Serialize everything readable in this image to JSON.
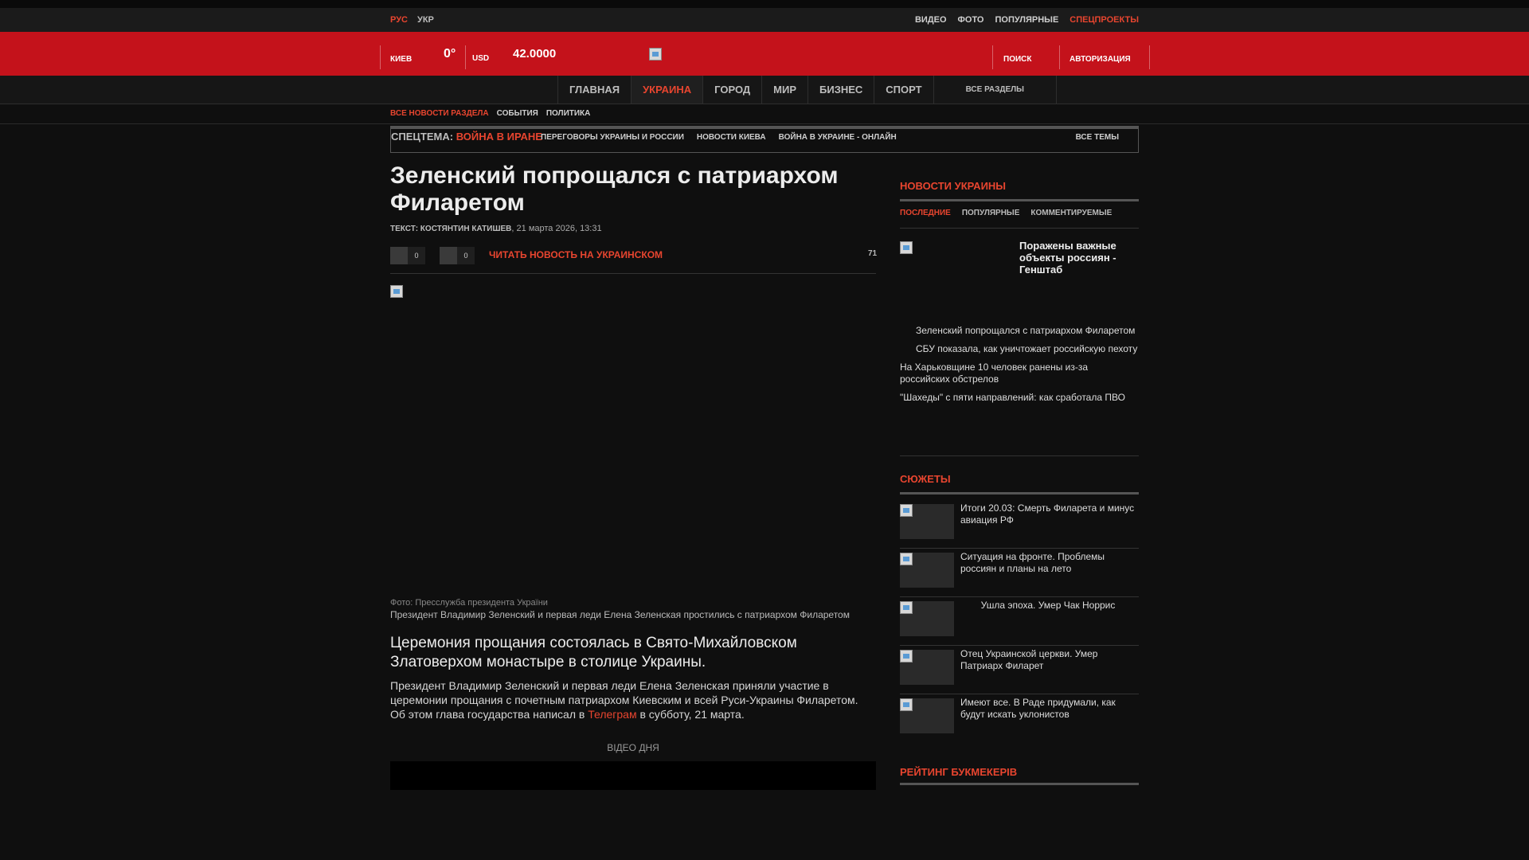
{
  "topbar": {
    "languages": [
      {
        "label": "РУС",
        "active": true
      },
      {
        "label": "УКР",
        "active": false
      }
    ],
    "links": [
      {
        "label": "ВИДЕО",
        "highlight": false
      },
      {
        "label": "ФОТО",
        "highlight": false
      },
      {
        "label": "ПОПУЛЯРНЫЕ",
        "highlight": false
      },
      {
        "label": "СПЕЦПРОЕКТЫ",
        "highlight": true
      }
    ]
  },
  "header": {
    "city": "КИЕВ",
    "temperature": "0°",
    "currency": "USD",
    "rate": "42.0000",
    "search_label": "ПОИСК",
    "auth_label": "АВТОРИЗАЦИЯ",
    "logo_icon": "broken-image-icon"
  },
  "nav": {
    "items": [
      {
        "label": "ГЛАВНАЯ",
        "active": false
      },
      {
        "label": "УКРАИНА",
        "active": true
      },
      {
        "label": "ГОРОД",
        "active": false
      },
      {
        "label": "МИР",
        "active": false
      },
      {
        "label": "БИЗНЕС",
        "active": false
      },
      {
        "label": "СПОРТ",
        "active": false
      }
    ],
    "all_sections": "ВСЕ РАЗДЕЛЫ"
  },
  "subnav": [
    "ВСЕ НОВОСТИ РАЗДЕЛА",
    "СОБЫТИЯ",
    "ПОЛИТИКА"
  ],
  "spec": {
    "label": "СПЕЦТЕМА:",
    "hot": "ВОЙНА В ИРАНЕ",
    "links": [
      "ПЕРЕГОВОРЫ УКРАИНЫ И РОССИИ",
      "НОВОСТИ КИЕВА",
      "ВОЙНА В УКРАИНЕ - ОНЛАЙН"
    ],
    "all": "ВСЕ ТЕМЫ"
  },
  "article": {
    "title": "Зеленский попрощался с патриархом Филаретом",
    "author": "ТЕКСТ: КОСТЯНТИН КАТИШЕВ",
    "date": "21 марта 2026, 13:31",
    "share_counts": [
      "0",
      "0"
    ],
    "read_ukrainian": "ЧИТАТЬ НОВОСТЬ НА УКРАИНСКОМ",
    "views": "71",
    "photo_source": "Фото: Пресслужба президента України",
    "photo_caption": "Президент Владимир Зеленский и первая леди Елена Зеленская простились с патриархом Филаретом",
    "lead": "Церемония прощания состоялась в Свято-Михайловском Златоверхом монастыре в столице Украины.",
    "body_before": "Президент Владимир Зеленский и первая леди Елена Зеленская приняли участие в церемонии прощания с почетным патриархом Киевским и всей Руси-Украины Филаретом. Об этом глава государства написал в ",
    "body_link": "Телеграм",
    "body_after": " в субботу, 21 марта.",
    "video_label": "ВІДЕО ДНЯ"
  },
  "sidebar": {
    "news_heading": "НОВОСТИ УКРАИНЫ",
    "tabs": [
      {
        "label": "ПОСЛЕДНИЕ",
        "active": true
      },
      {
        "label": "ПОПУЛЯРНЫЕ",
        "active": false
      },
      {
        "label": "КОММЕНТИРУЕМЫЕ",
        "active": false
      }
    ],
    "featured_title": "Поражены важные объекты россиян - Генштаб",
    "news": [
      {
        "text": "Зеленский попрощался с патриархом Филаретом",
        "indent": true
      },
      {
        "text": "СБУ показала, как уничтожает российскую пехоту",
        "indent": true
      },
      {
        "text": "На Харьковщине 10 человек ранены из-за российских обстрелов",
        "indent": false
      },
      {
        "text": "\"Шахеды\" с пяти направлений: как сработала ПВО",
        "indent": false
      }
    ],
    "stories_heading": "СЮЖЕТЫ",
    "stories": [
      {
        "title": "Итоги 20.03: Смерть Филарета и минус авиация РФ",
        "center": false
      },
      {
        "title": "Ситуация на фронте. Проблемы россиян и планы на лето",
        "center": false
      },
      {
        "title": "Ушла эпоха. Умер Чак Норрис",
        "center": true
      },
      {
        "title": "Отец Украинской церкви. Умер Патриарх Филарет",
        "center": false
      },
      {
        "title": "Имеют все. В Раде придумали, как будут искать уклонистов",
        "center": false
      }
    ],
    "rating_heading": "РЕЙТИНГ БУКМЕКЕРІВ"
  },
  "colors": {
    "accent": "#e8452f",
    "header_red": "#c4121b",
    "background": "#0f0f0f"
  }
}
